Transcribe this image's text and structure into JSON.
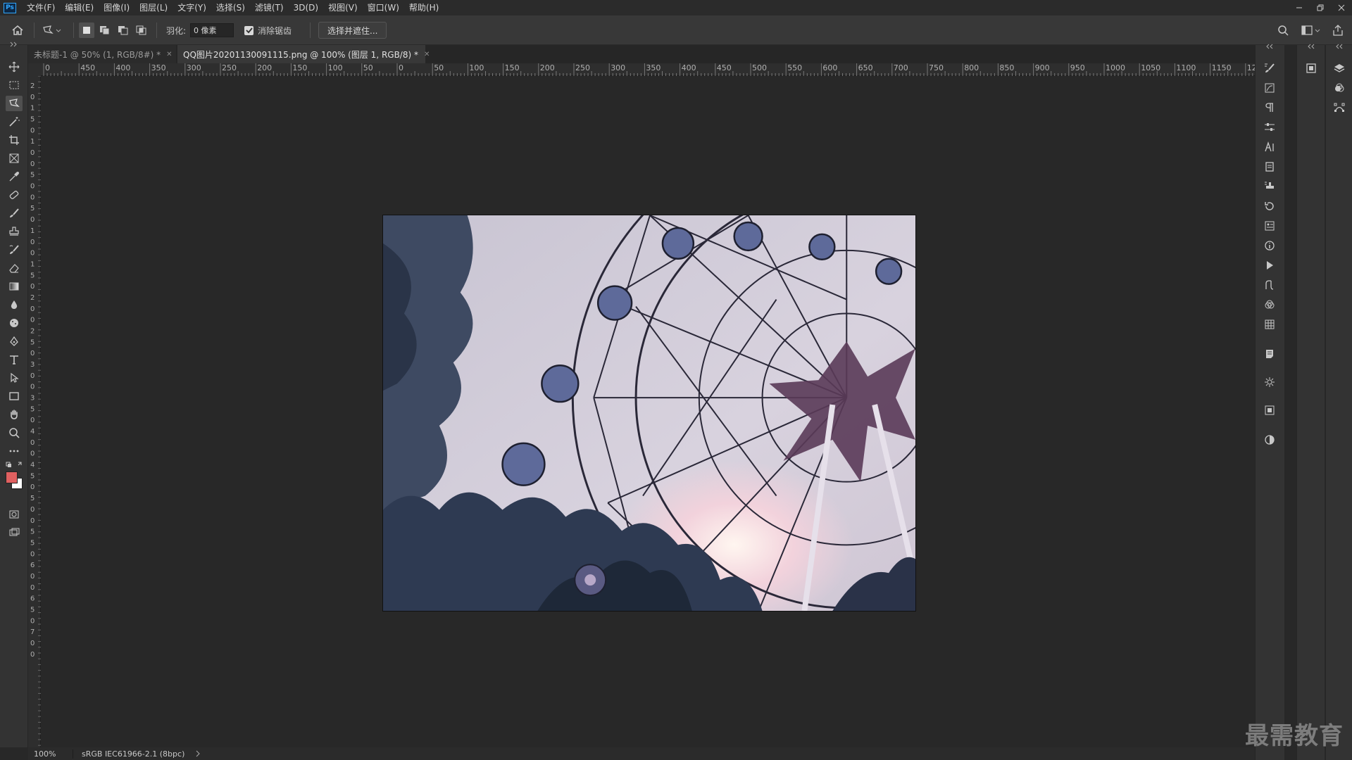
{
  "app": {
    "logo": "Ps"
  },
  "menu": [
    {
      "label": "文件(F)"
    },
    {
      "label": "编辑(E)"
    },
    {
      "label": "图像(I)"
    },
    {
      "label": "图层(L)"
    },
    {
      "label": "文字(Y)"
    },
    {
      "label": "选择(S)"
    },
    {
      "label": "滤镜(T)"
    },
    {
      "label": "3D(D)"
    },
    {
      "label": "视图(V)"
    },
    {
      "label": "窗口(W)"
    },
    {
      "label": "帮助(H)"
    }
  ],
  "options": {
    "feather_label": "羽化:",
    "feather_value": "0 像素",
    "antialias_label": "消除锯齿",
    "antialias_checked": true,
    "select_mask_label": "选择并遮住..."
  },
  "tabs": [
    {
      "label": "未标题-1 @ 50% (1, RGB/8#) *",
      "active": false
    },
    {
      "label": "QQ图片20201130091115.png @ 100% (图层 1, RGB/8) *",
      "active": true
    }
  ],
  "ruler_h": [
    "0",
    "450",
    "400",
    "350",
    "300",
    "250",
    "200",
    "150",
    "100",
    "50",
    "0",
    "50",
    "100",
    "150",
    "200",
    "250",
    "300",
    "350",
    "400",
    "450",
    "500",
    "550",
    "600",
    "650",
    "700",
    "750",
    "800",
    "850",
    "900",
    "950",
    "1000",
    "1050",
    "1100",
    "1150",
    "1200"
  ],
  "ruler_v": [
    "2",
    "0",
    "1",
    "5",
    "0",
    "1",
    "0",
    "0",
    "5",
    "0",
    "0",
    "5",
    "0",
    "1",
    "0",
    "0",
    "1",
    "5",
    "0",
    "2",
    "0",
    "0",
    "2",
    "5",
    "0",
    "3",
    "0",
    "0",
    "3",
    "5",
    "0",
    "4",
    "0",
    "0",
    "4",
    "5",
    "0",
    "5",
    "0",
    "0",
    "5",
    "5",
    "0",
    "6",
    "0",
    "0",
    "6",
    "5",
    "0",
    "7",
    "0",
    "0"
  ],
  "status": {
    "zoom": "100%",
    "profile": "sRGB IEC61966-2.1 (8bpc)"
  },
  "colors": {
    "foreground": "#e06060",
    "background": "#ffffff",
    "accent": "#31a8ff"
  },
  "watermark": "最需教育"
}
